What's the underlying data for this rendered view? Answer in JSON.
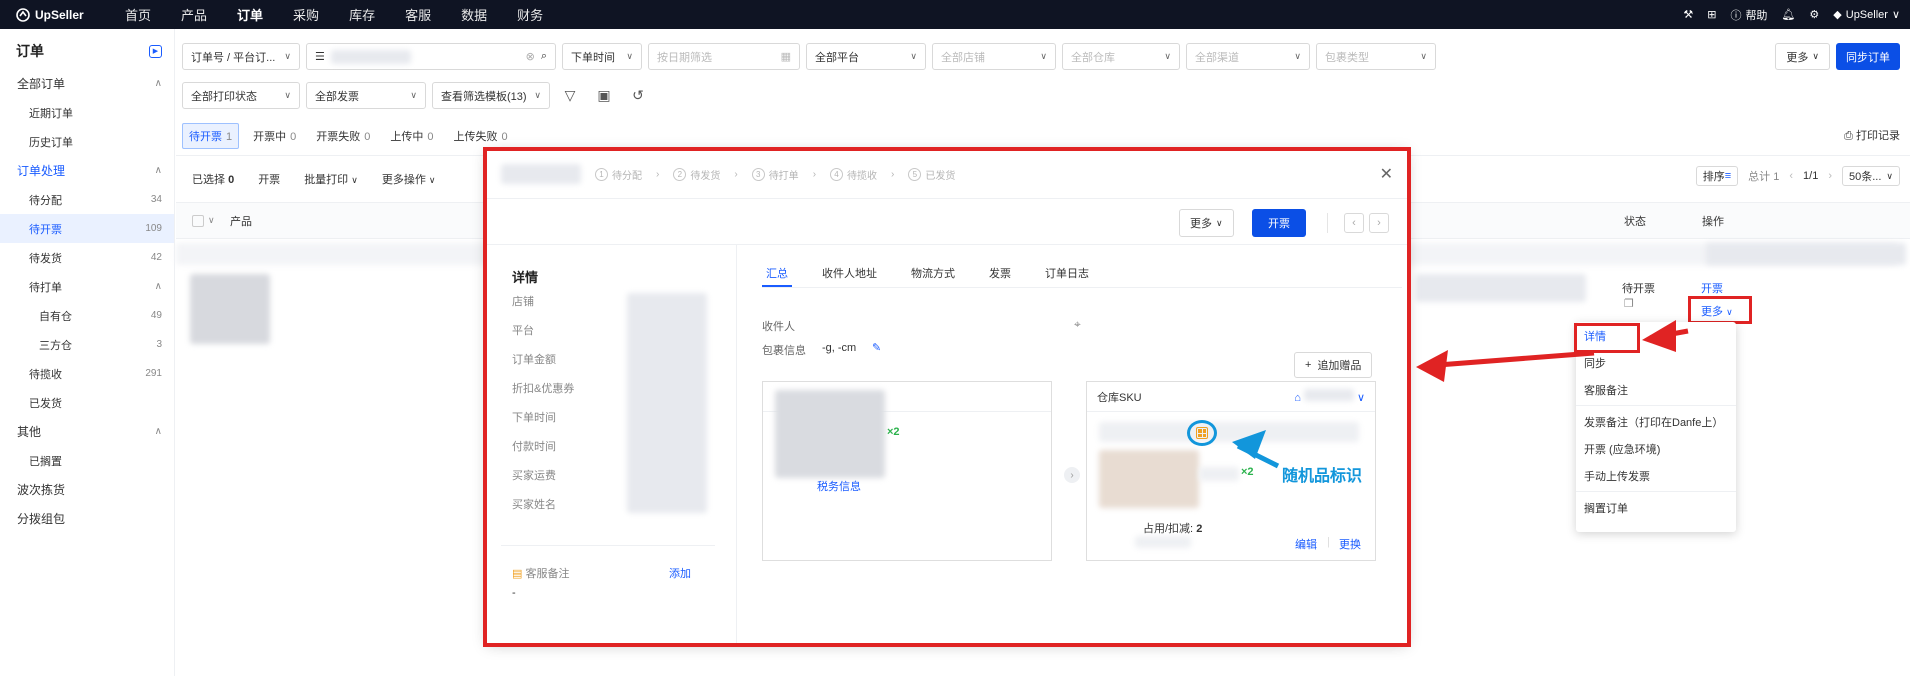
{
  "topnav": {
    "brand": "UpSeller",
    "items": [
      "首页",
      "产品",
      "订单",
      "采购",
      "库存",
      "客服",
      "数据",
      "财务"
    ],
    "active": "订单",
    "help": "帮助",
    "user": "UpSeller"
  },
  "sidebar": {
    "title": "订单",
    "all_orders": "全部订单",
    "recent": "近期订单",
    "history": "历史订单",
    "processing": "订单处理",
    "to_assign": "待分配",
    "to_assign_n": "34",
    "to_invoice": "待开票",
    "to_invoice_n": "109",
    "to_ship": "待发货",
    "to_ship_n": "42",
    "to_print": "待打单",
    "own_wh": "自有仓",
    "own_wh_n": "49",
    "third_wh": "三方仓",
    "third_wh_n": "3",
    "to_pickup": "待揽收",
    "to_pickup_n": "291",
    "shipped": "已发货",
    "other": "其他",
    "shelved": "已搁置",
    "wave": "波次拣货",
    "split": "分拨组包"
  },
  "filters": {
    "search_type": "订单号 / 平台订...",
    "time": "下单时间",
    "date_ph": "按日期筛选",
    "platform": "全部平台",
    "shop": "全部店铺",
    "warehouse": "全部仓库",
    "channel": "全部渠道",
    "pkg": "包裹类型",
    "print_state": "全部打印状态",
    "invoice": "全部发票",
    "template": "查看筛选模板(13)",
    "more": "更多",
    "sync": "同步订单"
  },
  "substatus": [
    {
      "label": "待开票",
      "n": "1"
    },
    {
      "label": "开票中",
      "n": "0"
    },
    {
      "label": "开票失败",
      "n": "0"
    },
    {
      "label": "上传中",
      "n": "0"
    },
    {
      "label": "上传失败",
      "n": "0"
    }
  ],
  "print_log": "打印记录",
  "tablebar": {
    "selected": "已选择",
    "selected_n": "0",
    "invoice": "开票",
    "batch_print": "批量打印",
    "more_ops": "更多操作",
    "sort": "排序",
    "total": "总计 1",
    "page": "1/1",
    "per_page": "50条..."
  },
  "table": {
    "product": "产品",
    "status": "状态",
    "action": "操作",
    "row_status": "待开票",
    "row_action": "开票",
    "row_more": "更多"
  },
  "modal": {
    "steps": [
      {
        "n": "1",
        "label": "待分配"
      },
      {
        "n": "2",
        "label": "待发货"
      },
      {
        "n": "3",
        "label": "待打单"
      },
      {
        "n": "4",
        "label": "待揽收"
      },
      {
        "n": "5",
        "label": "已发货"
      }
    ],
    "more": "更多",
    "invoice": "开票",
    "detail": "详情",
    "fields": [
      "店铺",
      "平台",
      "订单金额",
      "折扣&优惠券",
      "下单时间",
      "付款时间",
      "买家运费",
      "买家姓名"
    ],
    "cs_note": "客服备注",
    "add": "添加",
    "dash": "-",
    "tabs": [
      "汇总",
      "收件人地址",
      "物流方式",
      "发票",
      "订单日志"
    ],
    "recipient": "收件人",
    "pkg_info": "包裹信息",
    "pkg_val": "-g, -cm",
    "add_gift": "追加赠品",
    "qty": "×2",
    "tax_info": "税务信息",
    "wh_sku": "仓库SKU",
    "occupy": "占用/扣减:",
    "occupy_n": "2",
    "edit": "编辑",
    "replace": "更换"
  },
  "annotation": "随机品标识",
  "menu": [
    "详情",
    "同步",
    "客服备注",
    "发票备注（打印在Danfe上）",
    "开票 (应急环境)",
    "手动上传发票",
    "搁置订单"
  ]
}
